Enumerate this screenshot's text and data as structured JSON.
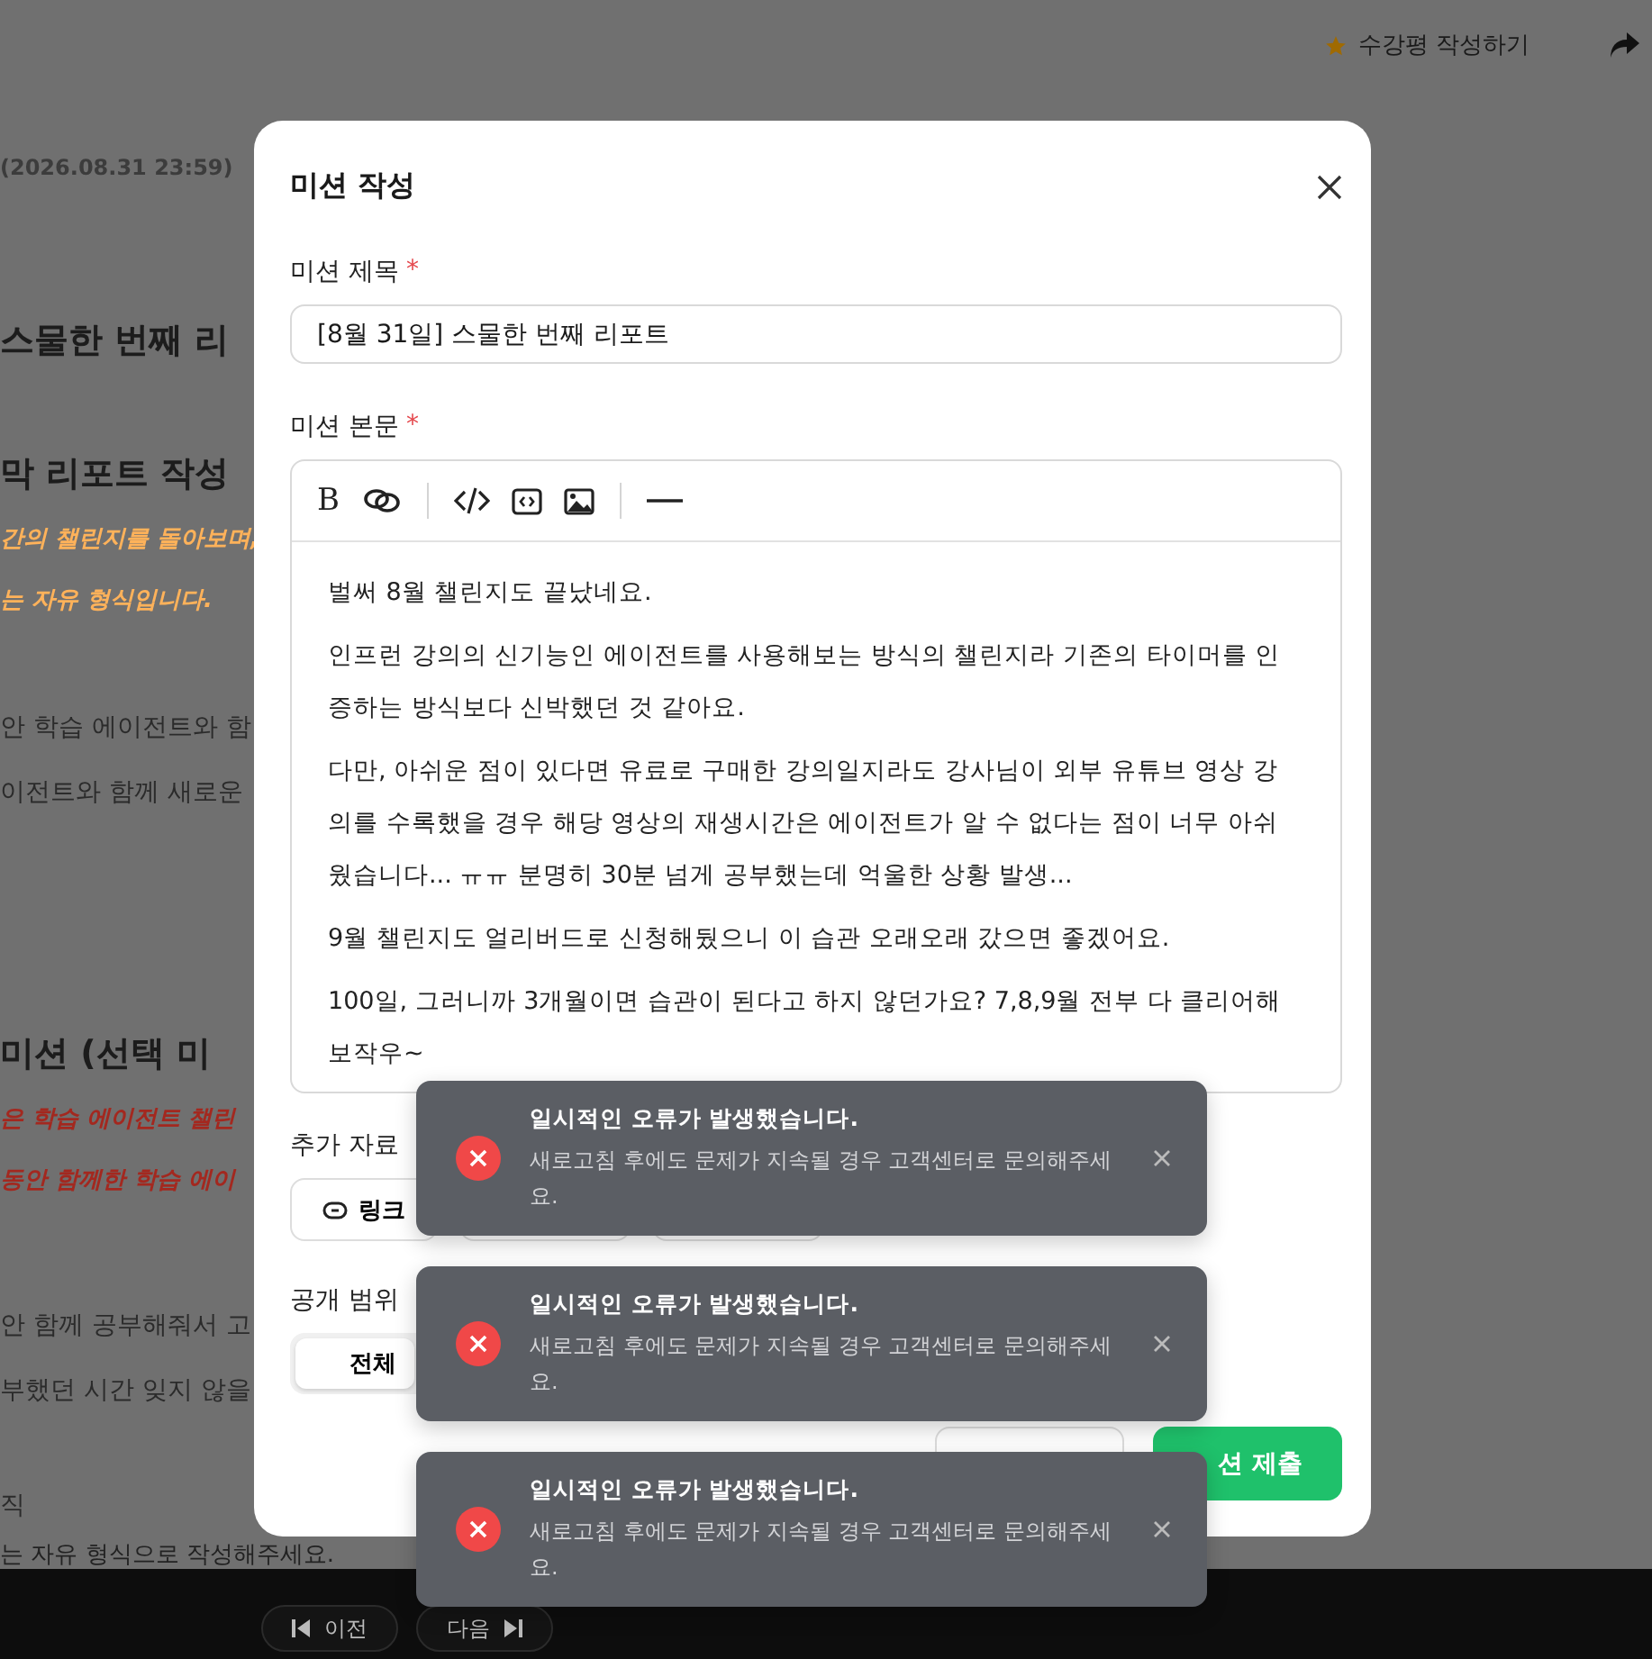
{
  "header": {
    "review_link": "수강평 작성하기"
  },
  "background_content": [
    {
      "kind": "meta",
      "text": "(2026.08.31 23:59)"
    },
    {
      "kind": "divider"
    },
    {
      "kind": "heading",
      "text": "스물한 번째 리"
    },
    {
      "kind": "divider"
    },
    {
      "kind": "heading",
      "text": "막 리포트 작성"
    },
    {
      "kind": "note",
      "text": "간의 챌린지를 돌아보며,"
    },
    {
      "kind": "note",
      "text": "는 자유 형식입니다."
    },
    {
      "kind": "body",
      "text": "안 학습 에이전트와 함"
    },
    {
      "kind": "body",
      "text": "이전트와 함께 새로운"
    },
    {
      "kind": "divider"
    },
    {
      "kind": "heading",
      "text": "미션 (선택 미"
    },
    {
      "kind": "warning",
      "text": "은 학습 에이전트 챌린"
    },
    {
      "kind": "warning",
      "text": "동안 함께한 학습 에이"
    },
    {
      "kind": "body",
      "text": "안 함께 공부해줘서 고"
    },
    {
      "kind": "body",
      "text": "부했던 시간 잊지 않을"
    },
    {
      "kind": "body",
      "text": "직"
    },
    {
      "kind": "faint",
      "text": "는 자유 형식으로 작성해주세요."
    }
  ],
  "modal": {
    "title": "미션 작성",
    "title_field": {
      "label": "미션 제목",
      "required": true,
      "required_mark": "*",
      "value": "[8월 31일] 스물한 번째 리포트"
    },
    "body_field": {
      "label": "미션 본문",
      "required": true,
      "required_mark": "*",
      "toolbar": [
        {
          "kind": "bold",
          "label": "B"
        },
        {
          "kind": "link"
        },
        {
          "kind": "separator"
        },
        {
          "kind": "code"
        },
        {
          "kind": "code-block"
        },
        {
          "kind": "image"
        },
        {
          "kind": "separator"
        },
        {
          "kind": "rule"
        }
      ],
      "paragraphs": [
        "벌써 8월 챌린지도 끝났네요.",
        "인프런 강의의 신기능인 에이전트를 사용해보는 방식의 챌린지라 기존의 타이머를 인증하는 방식보다 신박했던 것 같아요.",
        "다만, 아쉬운 점이 있다면 유료로 구매한 강의일지라도 강사님이 외부 유튜브 영상 강의를 수록했을 경우 해당 영상의 재생시간은 에이전트가 알 수 없다는 점이 너무 아쉬웠습니다... ㅠㅠ 분명히 30분 넘게 공부했는데 억울한 상황 발생...",
        "9월 챌린지도 얼리버드로 신청해뒀으니 이 습관 오래오래 갔으면 좋겠어요.",
        "100일, 그러니까 3개월이면 습관이 된다고 하지 않던가요? 7,8,9월 전부 다 클리어해보작우~"
      ]
    },
    "attachments": {
      "label": "추가 자료",
      "buttons": [
        {
          "kind": "link",
          "label": "링크"
        },
        {
          "kind": "hidden"
        },
        {
          "kind": "hidden"
        }
      ]
    },
    "visibility": {
      "label": "공개 범위",
      "options": [
        {
          "label": "전체",
          "selected": true
        }
      ]
    },
    "submit_button": "션 제출"
  },
  "toasts": [
    {
      "title": "일시적인 오류가 발생했습니다.",
      "message": "새로고침 후에도 문제가 지속될 경우 고객센터로 문의해주세요."
    },
    {
      "title": "일시적인 오류가 발생했습니다.",
      "message": "새로고침 후에도 문제가 지속될 경우 고객센터로 문의해주세요."
    },
    {
      "title": "일시적인 오류가 발생했습니다.",
      "message": "새로고침 후에도 문제가 지속될 경우 고객센터로 문의해주세요."
    }
  ],
  "bottom_nav": {
    "prev": "이전",
    "next": "다음"
  }
}
